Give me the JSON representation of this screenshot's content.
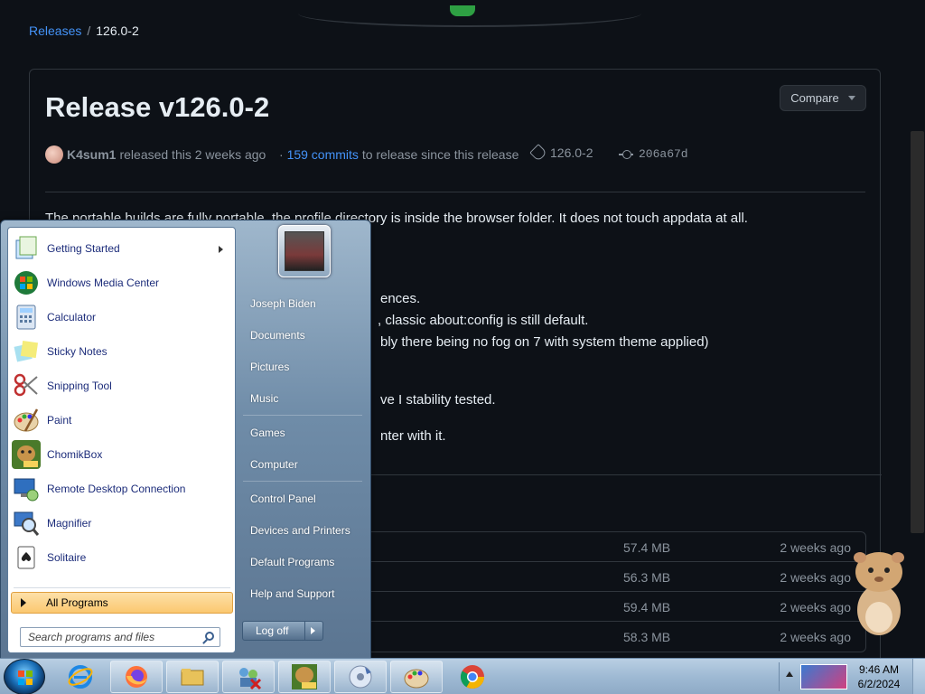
{
  "breadcrumb": {
    "releases": "Releases",
    "separator": "/",
    "current": "126.0-2"
  },
  "release": {
    "title": "Release v126.0-2",
    "compare_label": "Compare",
    "author": "K4sum1",
    "released_text": "released this 2 weeks ago",
    "commits_prefix": "·",
    "commits_link": "159 commits",
    "commits_suffix": "to release since this release",
    "tag": "126.0-2",
    "commit_sha": "206a67d"
  },
  "body_lines": [
    "The portable builds are fully portable, the profile directory is inside the browser folder. It does not touch appdata at all.",
    "ences.",
    ", classic about:config is still default.",
    "bly there being no fog on 7 with system theme applied)",
    "ve I stability tested.",
    "nter with it."
  ],
  "assets": [
    {
      "size": "57.4 MB",
      "date": "2 weeks ago"
    },
    {
      "size": "56.3 MB",
      "date": "2 weeks ago"
    },
    {
      "size": "59.4 MB",
      "date": "2 weeks ago"
    },
    {
      "size": "58.3 MB",
      "date": "2 weeks ago"
    }
  ],
  "start_menu": {
    "programs": [
      {
        "label": "Getting Started",
        "icon": "getting-started-icon",
        "color": "#6aa84f",
        "submenu": true
      },
      {
        "label": "Windows Media Center",
        "icon": "media-center-icon",
        "color": "#2e8b57"
      },
      {
        "label": "Calculator",
        "icon": "calculator-icon",
        "color": "#7da7d9"
      },
      {
        "label": "Sticky Notes",
        "icon": "sticky-notes-icon",
        "color": "#e8e06a"
      },
      {
        "label": "Snipping Tool",
        "icon": "snipping-tool-icon",
        "color": "#d04040"
      },
      {
        "label": "Paint",
        "icon": "paint-icon",
        "color": "#c79a5a"
      },
      {
        "label": "ChomikBox",
        "icon": "chomikbox-icon",
        "color": "#8a6a2a"
      },
      {
        "label": "Remote Desktop Connection",
        "icon": "remote-desktop-icon",
        "color": "#3c78c8"
      },
      {
        "label": "Magnifier",
        "icon": "magnifier-icon",
        "color": "#4a8ad0"
      },
      {
        "label": "Solitaire",
        "icon": "solitaire-icon",
        "color": "#2e4f9a"
      }
    ],
    "all_programs": "All Programs",
    "search_placeholder": "Search programs and files",
    "right_items": [
      "Joseph Biden",
      "Documents",
      "Pictures",
      "Music",
      "Games",
      "Computer",
      "Control Panel",
      "Devices and Printers",
      "Default Programs",
      "Help and Support"
    ],
    "log_off": "Log off"
  },
  "taskbar": {
    "apps": [
      "internet-explorer-icon",
      "firefox-icon",
      "explorer-icon",
      "network-icon",
      "chomikbox-icon",
      "media-player-icon",
      "paint-icon",
      "chrome-icon"
    ],
    "time": "9:46 AM",
    "date": "6/2/2024"
  }
}
